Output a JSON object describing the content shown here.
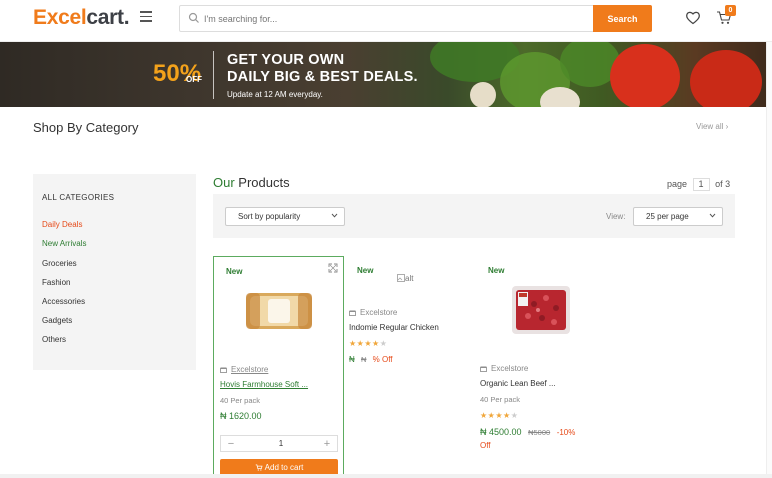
{
  "header": {
    "logo_part1": "Excel",
    "logo_part2": "cart.",
    "search_placeholder": "I'm searching for...",
    "search_button": "Search",
    "cart_count": "0",
    "icons": [
      "menu-icon",
      "search-icon",
      "heart-icon",
      "cart-icon"
    ]
  },
  "banner": {
    "percent": "50%",
    "off": "OFF",
    "line1": "GET YOUR OWN",
    "line2": "DAILY BIG & BEST DEALS.",
    "line3": "Update at 12 AM everyday."
  },
  "category": {
    "title": "Shop By Category",
    "view_all": "View all ›"
  },
  "sidebar": {
    "header": "ALL CATEGORIES",
    "items": [
      {
        "label": "Daily Deals",
        "color": "#e64a19"
      },
      {
        "label": "New Arrivals",
        "color": "#2e7d32"
      },
      {
        "label": "Groceries",
        "color": "#333333"
      },
      {
        "label": "Fashion",
        "color": "#333333"
      },
      {
        "label": "Accessories",
        "color": "#333333"
      },
      {
        "label": "Gadgets",
        "color": "#333333"
      },
      {
        "label": "Others",
        "color": "#333333"
      }
    ]
  },
  "products_header": {
    "title_our": "Our",
    "title_rest": " Products",
    "page_label": "page",
    "page_current": "1",
    "page_total": "of 3",
    "sort_label": "Sort by popularity",
    "view_label": "View:",
    "per_page": "25 per page"
  },
  "products": [
    {
      "badge": "New",
      "store": "Excelstore",
      "name": "Hovis Farmhouse Soft ...",
      "subtitle": "40 Per pack",
      "price": "₦ 1620.00",
      "quantity": "1",
      "add_to_cart": "Add to cart"
    },
    {
      "badge": "New",
      "image_alt": "alt",
      "store": "Excelstore",
      "name": "Indomie Regular Chicken",
      "rating": 4,
      "price_symbol": "₦",
      "old_price_symbol": "₦",
      "discount": "% Off"
    },
    {
      "badge": "New",
      "store": "Excelstore",
      "name": "Organic Lean Beef ...",
      "subtitle": "40 Per pack",
      "rating": 4,
      "price": "₦ 4500.00",
      "old_price": "₦5000",
      "discount": "-10%",
      "discount_suffix": "Off"
    }
  ],
  "colors": {
    "brand_orange": "#f07b1b",
    "brand_green": "#2e7d32",
    "sale_red": "#e64a19"
  }
}
